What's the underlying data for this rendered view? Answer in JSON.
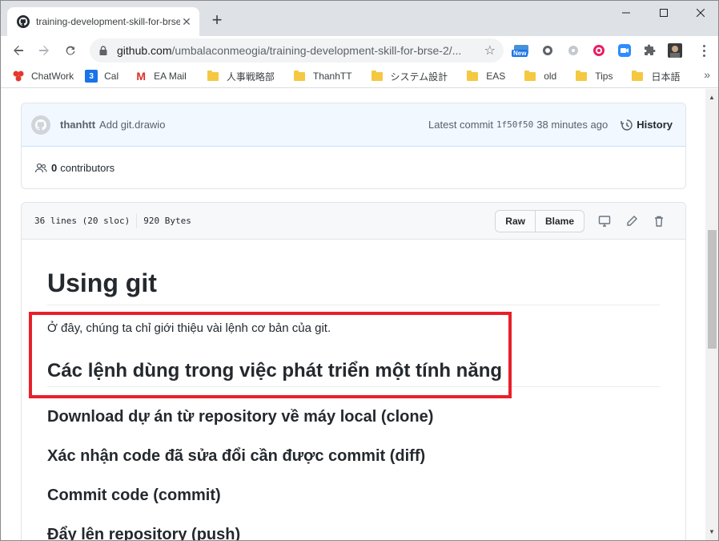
{
  "browser": {
    "tab_title": "training-development-skill-for-brse-2/",
    "new_tab": "+",
    "url_host": "github.com",
    "url_path": "/umbalaconmeogia/training-development-skill-for-brse-2/...",
    "ext_badge": "New",
    "tab_close": "✕"
  },
  "bookmarks": [
    {
      "label": "ChatWork",
      "icon": "chatwork-icon"
    },
    {
      "label": "Cal",
      "icon": "calendar-icon",
      "icon_text": "3"
    },
    {
      "label": "EA Mail",
      "icon": "gmail-icon",
      "icon_text": "M"
    },
    {
      "label": "人事戦略部",
      "icon": "folder-icon"
    },
    {
      "label": "ThanhTT",
      "icon": "folder-icon"
    },
    {
      "label": "システム設計",
      "icon": "folder-icon"
    },
    {
      "label": "EAS",
      "icon": "folder-icon"
    },
    {
      "label": "old",
      "icon": "folder-icon"
    },
    {
      "label": "Tips",
      "icon": "folder-icon"
    },
    {
      "label": "日本語",
      "icon": "folder-icon"
    }
  ],
  "commit": {
    "author": "thanhtt",
    "message": "Add git.drawio",
    "latest_label": "Latest commit",
    "sha": "1f50f50",
    "time": "38 minutes ago",
    "history_label": "History",
    "contributors_count": "0",
    "contributors_label": "contributors"
  },
  "file": {
    "lines": "36 lines (20 sloc)",
    "size": "920 Bytes",
    "raw_label": "Raw",
    "blame_label": "Blame"
  },
  "content": {
    "h1": "Using git",
    "intro": "Ở đây, chúng ta chỉ giới thiệu vài lệnh cơ bản của git.",
    "h2": "Các lệnh dùng trong việc phát triển một tính năng",
    "h3_items": [
      "Download dự án từ repository về máy local (clone)",
      "Xác nhận code đã sửa đổi cần được commit (diff)",
      "Commit code (commit)",
      "Đẩy lên repository (push)"
    ]
  },
  "colors": {
    "highlight_border": "#e8202a",
    "commit_bg": "#f1f8ff",
    "tabstrip_bg": "#dee1e6"
  }
}
